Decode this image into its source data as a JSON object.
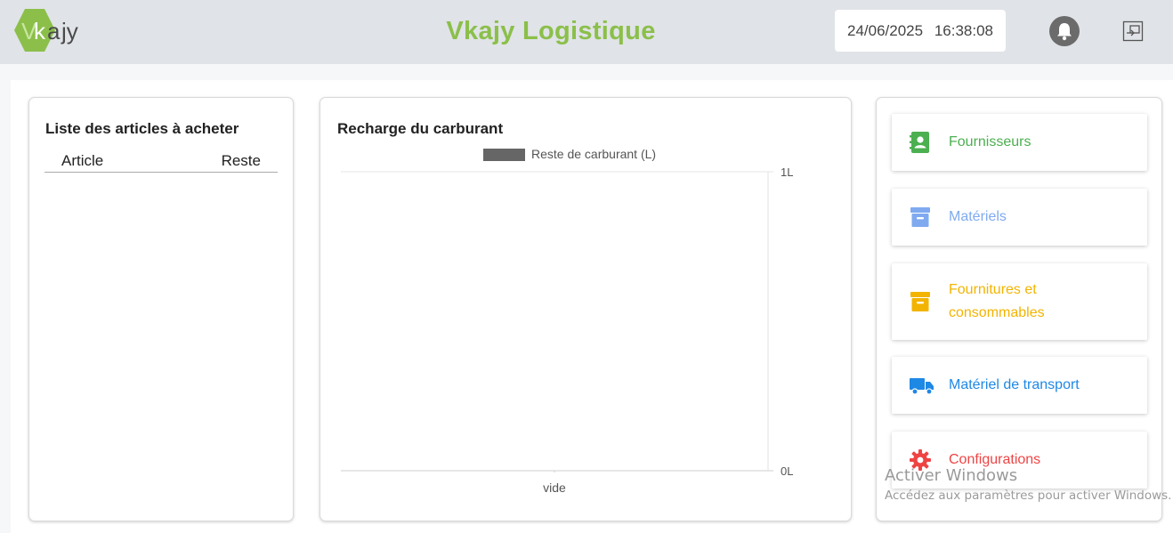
{
  "header": {
    "logo_text": "Vkajy",
    "title": "Vkajy Logistique",
    "date": "24/06/2025",
    "time": "16:38:08",
    "title_color": "#8bbf4a"
  },
  "articles_list": {
    "title": "Liste des articles à acheter",
    "columns": [
      "Article",
      "Reste"
    ],
    "rows": []
  },
  "fuel_chart": {
    "title": "Recharge du carburant"
  },
  "chart_data": {
    "type": "bar",
    "categories": [
      "vide"
    ],
    "series": [
      {
        "name": "Reste de carburant (L)",
        "values": [
          0
        ],
        "color": "#666666"
      }
    ],
    "y_ticks": [
      "1L",
      "0L"
    ],
    "ylim": [
      0,
      1
    ],
    "y_axis_side": "right",
    "legend_position": "top",
    "grid": true
  },
  "nav": {
    "items": [
      {
        "label": "Fournisseurs",
        "icon": "contact-book-icon",
        "color": "#4caf50"
      },
      {
        "label": "Matériels",
        "icon": "archive-box-icon",
        "color": "#7faaf0"
      },
      {
        "label": "Fournitures et consommables",
        "icon": "archive-box-icon",
        "color": "#f2b400"
      },
      {
        "label": "Matériel de transport",
        "icon": "truck-icon",
        "color": "#1e88e5"
      },
      {
        "label": "Configurations",
        "icon": "gear-icon",
        "color": "#ef4444"
      }
    ]
  },
  "watermark": {
    "line1": "Activer Windows",
    "line2": "Accédez aux paramètres pour activer Windows."
  }
}
